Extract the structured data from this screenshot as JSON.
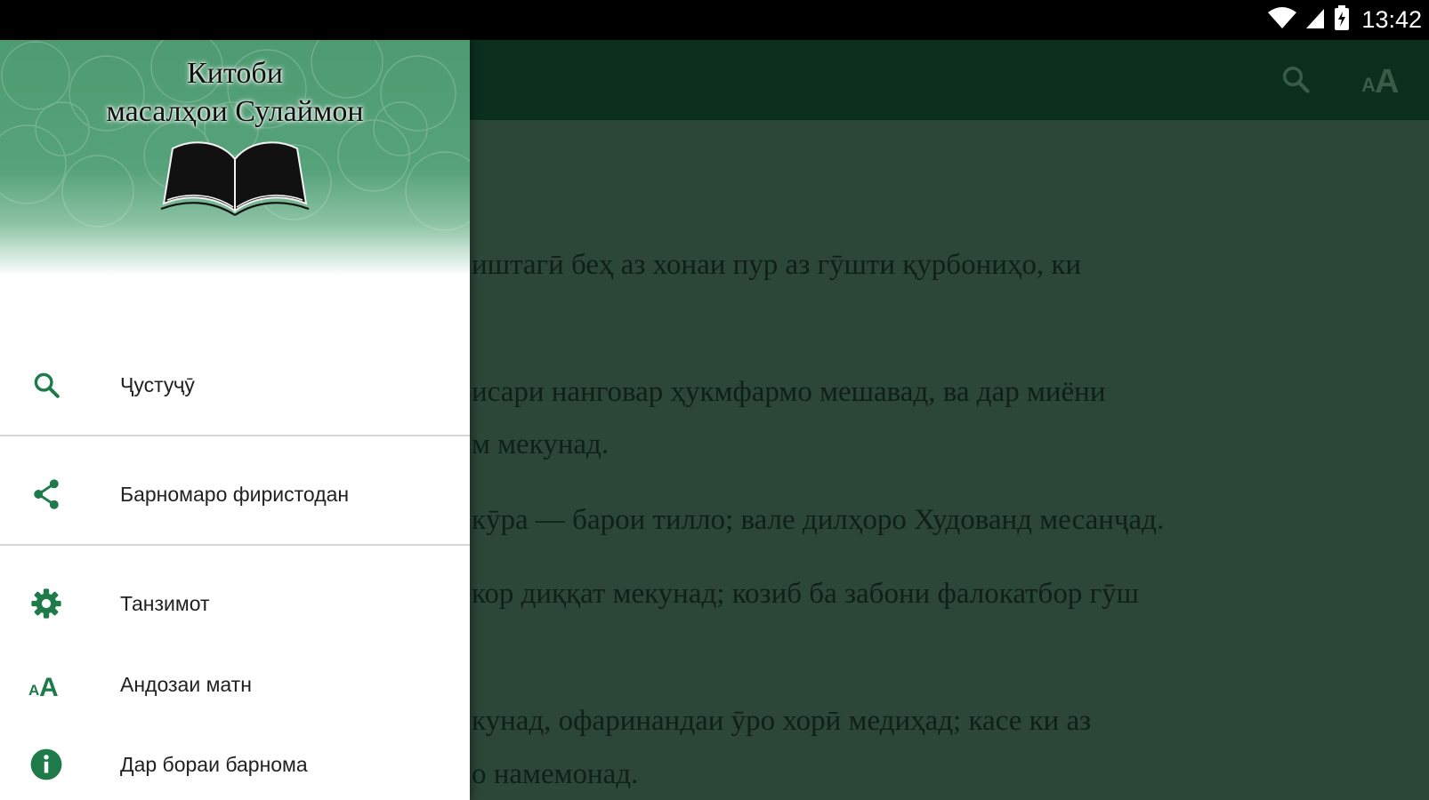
{
  "status_bar": {
    "time": "13:42"
  },
  "app_bar": {
    "icons": [
      "search-icon",
      "text-size-icon"
    ]
  },
  "reader": {
    "lines": [
      "иштагӣ беҳ аз хонаи пур аз гӯшти қурбониҳо, ки",
      "исари нанговар ҳукмфармо мешавад, ва дар миёни",
      "м мекунад.",
      "кӯра — барои тилло; вале дилҳоро Худованд месанҷад.",
      "кор диққат мекунад; козиб ба забони фалокатбор гӯш",
      "кунад, офаринандаи ӯро хорӣ медиҳад; касе ки аз",
      "о намемонад."
    ]
  },
  "drawer": {
    "header": {
      "title_line1": "Китоби",
      "title_line2": "масалҳои Сулаймон"
    },
    "menu": [
      {
        "label": "Ҷустуҷӯ",
        "icon": "search-icon"
      },
      {
        "label": "Барномаро фиристодан",
        "icon": "share-icon"
      },
      {
        "label": "Танзимот",
        "icon": "gear-icon"
      },
      {
        "label": "Андозаи матн",
        "icon": "text-size-icon"
      },
      {
        "label": "Дар бораи барнома",
        "icon": "info-icon"
      }
    ]
  },
  "colors": {
    "accent": "#1f7a4a",
    "app_bar": "#0b2f1d",
    "content_scrim": "#2c4637",
    "header_green": "#56a27a"
  }
}
